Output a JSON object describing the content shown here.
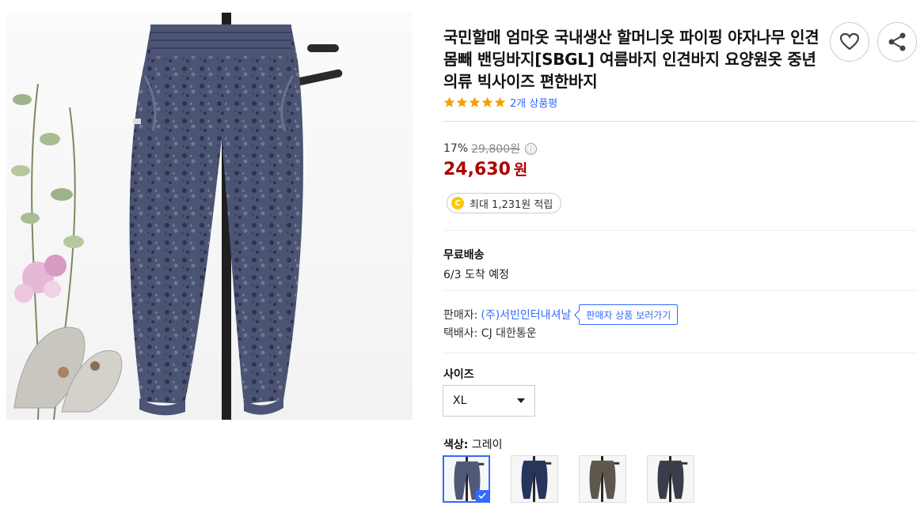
{
  "product": {
    "title": "국민할매 엄마옷 국내생산 할머니옷 파이핑 야자나무 인견 몸빼 밴딩바지[SBGL] 여름바지 인견바지 요양원옷 중년의류 빅사이즈 편한바지",
    "rating_stars": 5,
    "review_count": "2개 상품평"
  },
  "price": {
    "discount_rate": "17%",
    "original_price": "29,800원",
    "info_icon": "ⓘ",
    "sale_price": "24,630",
    "sale_unit": "원",
    "cash_coin": "C",
    "cash_text": "최대 1,231원 적립"
  },
  "shipping": {
    "title": "무료배송",
    "arrival": "6/3 도착 예정"
  },
  "seller": {
    "seller_label": "판매자:",
    "seller_name": "(주)서빈인터내셔날",
    "seller_link": "판매자 상품 보러가기",
    "courier": "택배사: CJ 대한통운"
  },
  "options": {
    "size_label": "사이즈",
    "size_value": "XL",
    "color_label": "색상:",
    "color_value": " 그레이",
    "swatches": [
      "그레이",
      "네이비",
      "브라운",
      "블랙"
    ]
  },
  "colors": {
    "accent": "#346aff",
    "price_red": "#ae0000",
    "star": "#f7a000",
    "coin": "#ffc800",
    "pants_gray": "#505a78",
    "pants_navy": "#27345c",
    "pants_brown": "#5d574c",
    "pants_black": "#3a3d4a"
  },
  "icons": {
    "wishlist": "heart-icon",
    "share": "share-icon",
    "dropdown": "caret-down-icon",
    "selected": "check-icon"
  }
}
